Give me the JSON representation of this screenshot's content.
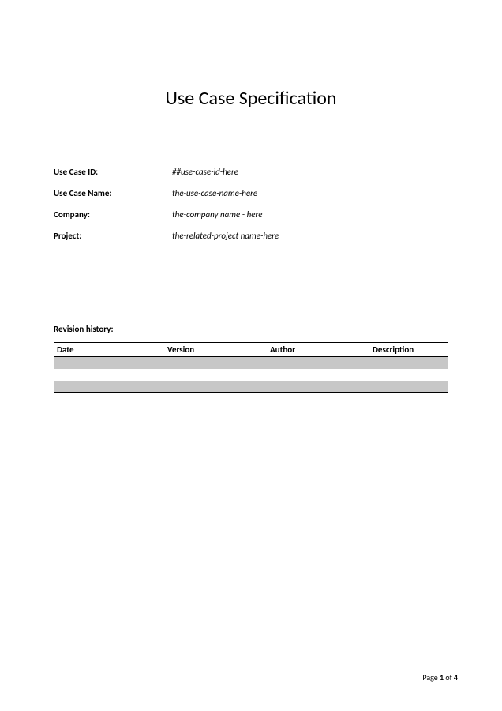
{
  "title": "Use Case Specification",
  "meta": {
    "use_case_id_label": "Use Case ID:",
    "use_case_id_value": "##use-case-id-here",
    "use_case_name_label": "Use Case Name:",
    "use_case_name_value": "the-use-case-name-here",
    "company_label": "Company:",
    "company_value": "the-company name - here",
    "project_label": "Project:",
    "project_value": "the-related-project name-here"
  },
  "revision": {
    "title": "Revision history:",
    "headers": {
      "date": "Date",
      "version": "Version",
      "author": "Author",
      "description": "Description"
    }
  },
  "footer": {
    "prefix": "Page ",
    "current": "1",
    "middle": " of ",
    "total": "4"
  }
}
